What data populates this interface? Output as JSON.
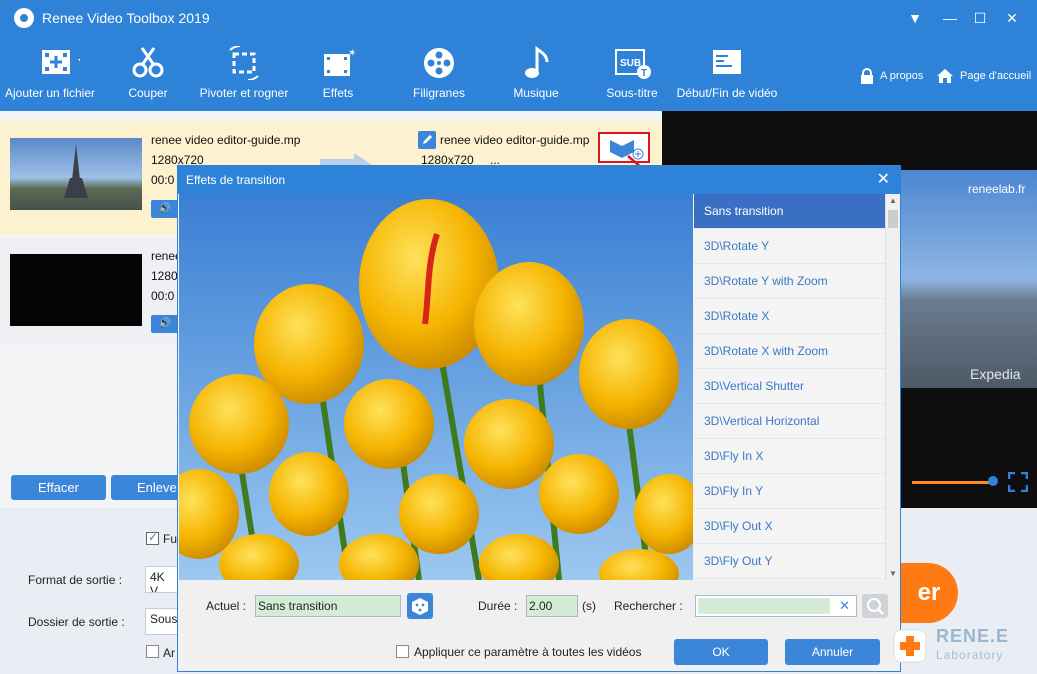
{
  "app": {
    "title": "Renee Video Toolbox 2019"
  },
  "window_controls": {
    "menu": "▼",
    "minimize": "—",
    "maximize": "☐",
    "close": "✕"
  },
  "toolbar": {
    "items": [
      {
        "label": "Ajouter un fichier",
        "icon": "film-add-icon"
      },
      {
        "label": "Couper",
        "icon": "scissors-icon"
      },
      {
        "label": "Pivoter et rogner",
        "icon": "crop-rotate-icon"
      },
      {
        "label": "Effets",
        "icon": "film-effects-icon"
      },
      {
        "label": "Filigranes",
        "icon": "film-reel-icon"
      },
      {
        "label": "Musique",
        "icon": "music-note-icon"
      },
      {
        "label": "Sous-titre",
        "icon": "subtitle-icon"
      },
      {
        "label": "Début/Fin de vidéo",
        "icon": "video-start-end-icon"
      }
    ],
    "about": "A propos",
    "home": "Page d'accueil"
  },
  "videos": [
    {
      "name": "renee video editor-guide.mp",
      "resolution": "1280x720",
      "time": "00:0",
      "out_name": "renee video editor-guide.mp",
      "out_resolution": "1280x720",
      "out_extra": "..."
    },
    {
      "name": "renee",
      "resolution": "1280",
      "time": "00:0"
    }
  ],
  "preview": {
    "watermark_top": "reneelab.fr",
    "watermark_bottom": "Expedia"
  },
  "bottom": {
    "clear_btn": "Effacer",
    "remove_btn": "Enlever",
    "merge_chk": "Fu",
    "format_label": "Format de sortie :",
    "format_value": "4K V",
    "folder_label": "Dossier de sortie :",
    "folder_value": "Sous",
    "shutdown_chk": "Ar",
    "start_btn": "er"
  },
  "dialog": {
    "title": "Effets de transition",
    "transitions": [
      "Sans transition",
      "3D\\Rotate Y",
      "3D\\Rotate Y with Zoom",
      "3D\\Rotate X",
      "3D\\Rotate X with Zoom",
      "3D\\Vertical Shutter",
      "3D\\Vertical Horizontal",
      "3D\\Fly In X",
      "3D\\Fly In Y",
      "3D\\Fly Out X",
      "3D\\Fly Out Y"
    ],
    "current_label": "Actuel :",
    "current_value": "Sans transition",
    "duration_label": "Durée :",
    "duration_value": "2.00",
    "duration_unit": "(s)",
    "search_label": "Rechercher :",
    "search_value": "",
    "apply_all": "Appliquer ce paramètre à toutes les vidéos",
    "ok": "OK",
    "cancel": "Annuler"
  },
  "brand": {
    "name": "RENE.E",
    "sub": "Laboratory"
  },
  "colors": {
    "accent": "#2e83d8",
    "selection": "#3b6fc4",
    "start": "#ff7a12",
    "highlight": "#e0161c"
  }
}
